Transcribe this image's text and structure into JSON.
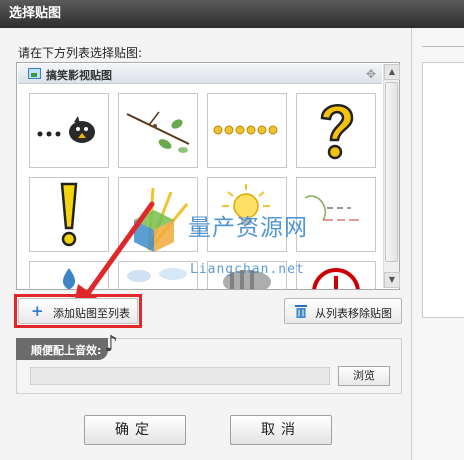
{
  "window": {
    "title": "选择贴图"
  },
  "instruction": "请在下方列表选择贴图:",
  "category": {
    "label": "搞笑影视贴图"
  },
  "stickers": [
    {
      "name": "bird-dots"
    },
    {
      "name": "branch-leaves"
    },
    {
      "name": "yellow-dots"
    },
    {
      "name": "question-mark"
    },
    {
      "name": "exclamation-mark"
    },
    {
      "name": "yellow-rays"
    },
    {
      "name": "light-bulb"
    },
    {
      "name": "handwritten-note"
    },
    {
      "name": "blue-drop"
    },
    {
      "name": "light-blue-splash"
    },
    {
      "name": "gray-blur"
    },
    {
      "name": "red-stop-sign"
    }
  ],
  "watermark": {
    "cn": "量产资源网",
    "en": "Liangchan.net"
  },
  "buttons": {
    "add_to_list": "添加贴图至列表",
    "remove_from_list": "从列表移除贴图",
    "browse": "浏览",
    "ok": "确定",
    "cancel": "取消"
  },
  "sound": {
    "title": "顺便配上音效:",
    "path_value": ""
  },
  "colors": {
    "highlight": "#e0282a",
    "accent": "#2f7fd0",
    "titlebar": "#3a3a3a"
  }
}
